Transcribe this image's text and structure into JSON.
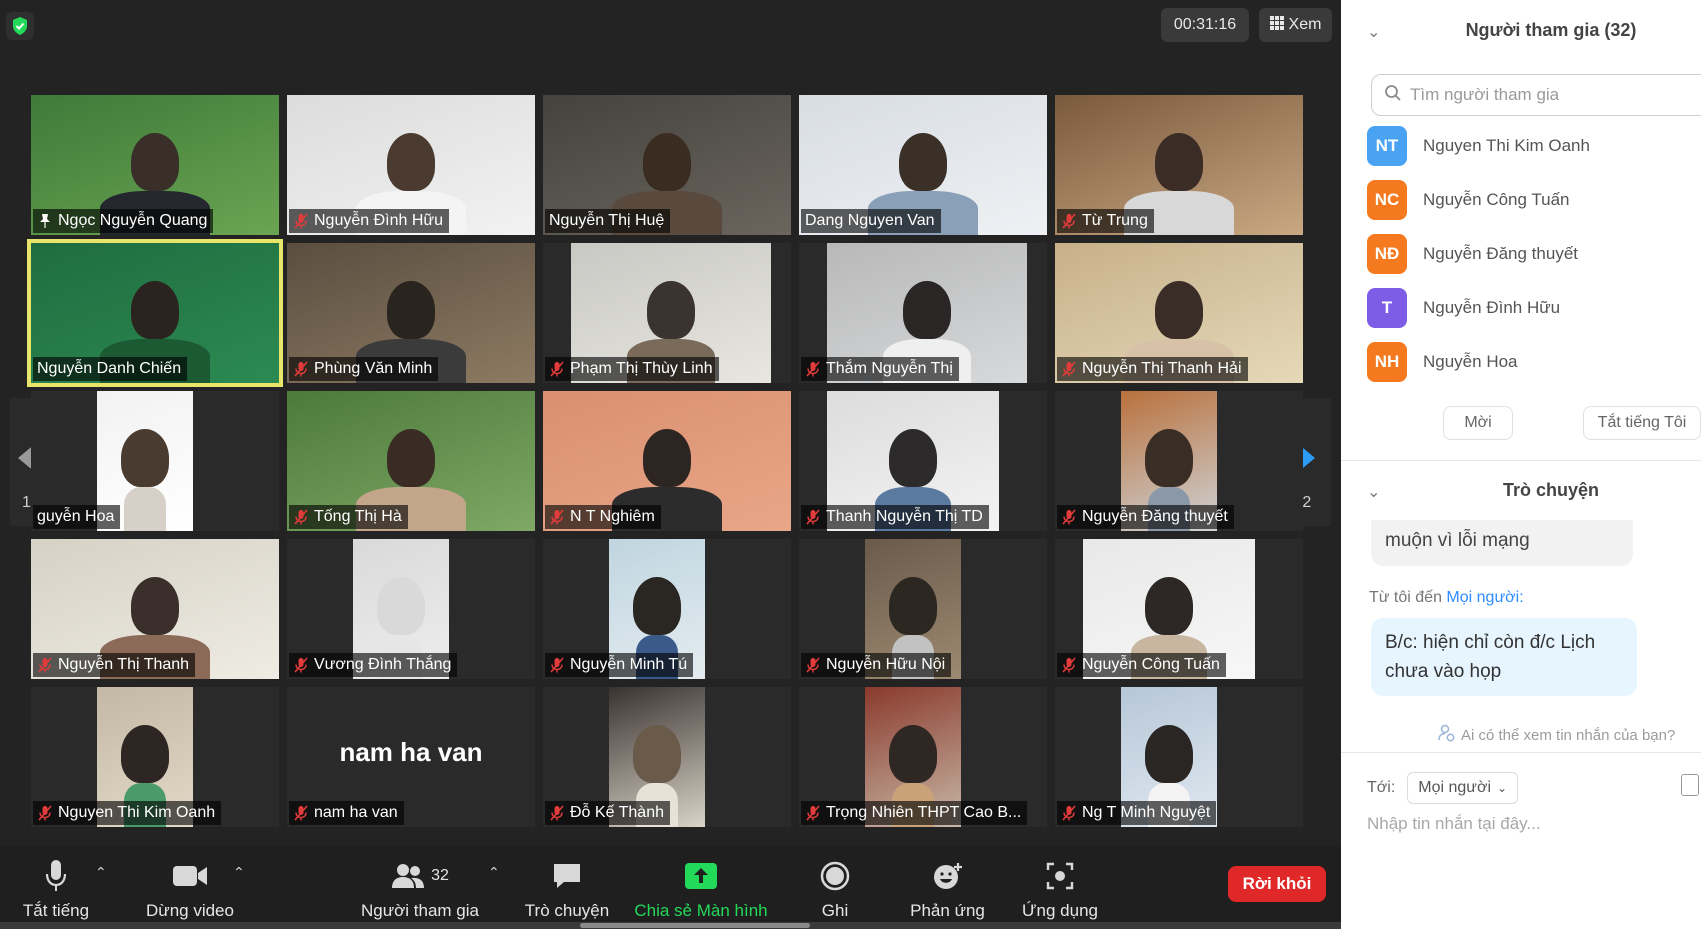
{
  "meeting": {
    "timer": "00:31:16",
    "view_label": "Xem",
    "page_indicator_left": "1/2",
    "page_indicator_right": "1/2",
    "tiles": [
      {
        "name": "Ngọc Nguyễn Quang",
        "icon": "pin-icon"
      },
      {
        "name": "Nguyễn Đình Hữu",
        "icon": "mic-off-icon"
      },
      {
        "name": "Nguyễn Thị Huệ",
        "icon": ""
      },
      {
        "name": "Dang Nguyen Van",
        "icon": ""
      },
      {
        "name": "Từ Trung",
        "icon": "mic-off-icon"
      },
      {
        "name": "Nguyễn Danh Chiến",
        "icon": "",
        "active": true
      },
      {
        "name": "Phùng Văn Minh",
        "icon": "mic-off-icon"
      },
      {
        "name": "Phạm Thị Thùy Linh",
        "icon": "mic-off-icon"
      },
      {
        "name": "Thắm Nguyễn Thị",
        "icon": "mic-off-icon"
      },
      {
        "name": "Nguyễn Thị Thanh Hải",
        "icon": "mic-off-icon"
      },
      {
        "name": "guyễn Hoa",
        "icon": ""
      },
      {
        "name": "Tống Thị Hà",
        "icon": "mic-off-icon"
      },
      {
        "name": "N T Nghiêm",
        "icon": "mic-off-icon"
      },
      {
        "name": "Thanh Nguyễn Thị TD",
        "icon": "mic-off-icon"
      },
      {
        "name": "Nguyễn Đăng thuyết",
        "icon": "mic-off-icon"
      },
      {
        "name": "Nguyễn Thị Thanh",
        "icon": "mic-off-icon"
      },
      {
        "name": "Vương Đình Thắng",
        "icon": "mic-off-icon"
      },
      {
        "name": "Nguyễn Minh Tú",
        "icon": "mic-off-icon"
      },
      {
        "name": "Nguyễn Hữu Nội",
        "icon": "mic-off-icon"
      },
      {
        "name": "Nguyễn Công Tuấn",
        "icon": "mic-off-icon"
      },
      {
        "name": "Nguyen Thi Kim Oanh",
        "icon": "mic-off-icon"
      },
      {
        "name": "nam ha van",
        "icon": "mic-off-icon",
        "video_off_label": "nam ha van"
      },
      {
        "name": "Đỗ Kế Thành",
        "icon": "mic-off-icon"
      },
      {
        "name": "Trọng Nhiên THPT Cao B...",
        "icon": "mic-off-icon"
      },
      {
        "name": "Ng T Minh Nguyệt",
        "icon": "mic-off-icon"
      }
    ]
  },
  "toolbar": {
    "mute_label": "Tắt tiếng",
    "video_label": "Dừng video",
    "participants_label": "Người tham gia",
    "participants_count": "32",
    "chat_label": "Trò chuyện",
    "share_label": "Chia sẻ Màn hình",
    "record_label": "Ghi",
    "reactions_label": "Phản ứng",
    "apps_label": "Ứng dụng",
    "leave_label": "Rời khỏi",
    "share_color": "#23d959",
    "leave_color": "#e02828"
  },
  "participants_panel": {
    "title": "Người tham gia (32)",
    "search_placeholder": "Tìm người tham gia",
    "items": [
      {
        "initials": "NT",
        "name": "Nguyen Thi Kim Oanh",
        "color": "#4aa3f2"
      },
      {
        "initials": "NC",
        "name": "Nguyễn Công Tuấn",
        "color": "#f57a1f"
      },
      {
        "initials": "NĐ",
        "name": "Nguyễn Đăng thuyết",
        "color": "#f57a1f"
      },
      {
        "initials": "T",
        "name": "Nguyễn Đình Hữu",
        "color": "#7d5ce6"
      },
      {
        "initials": "NH",
        "name": "Nguyễn Hoa",
        "color": "#f57a1f"
      }
    ],
    "invite_label": "Mời",
    "mute_all_label": "Tắt tiếng Tôi"
  },
  "chat_panel": {
    "title": "Trò chuyện",
    "prev_message_tail": "muộn vì lỗi mạng",
    "from_prefix": "Từ tôi đến",
    "from_target": "Mọi người:",
    "message": "B/c: hiện chỉ còn đ/c Lịch chưa vào họp",
    "who_can_see": "Ai có thể xem tin nhắn của bạn?",
    "to_label": "Tới:",
    "to_value": "Mọi người",
    "composer_placeholder": "Nhập tin nhắn tại đây..."
  }
}
